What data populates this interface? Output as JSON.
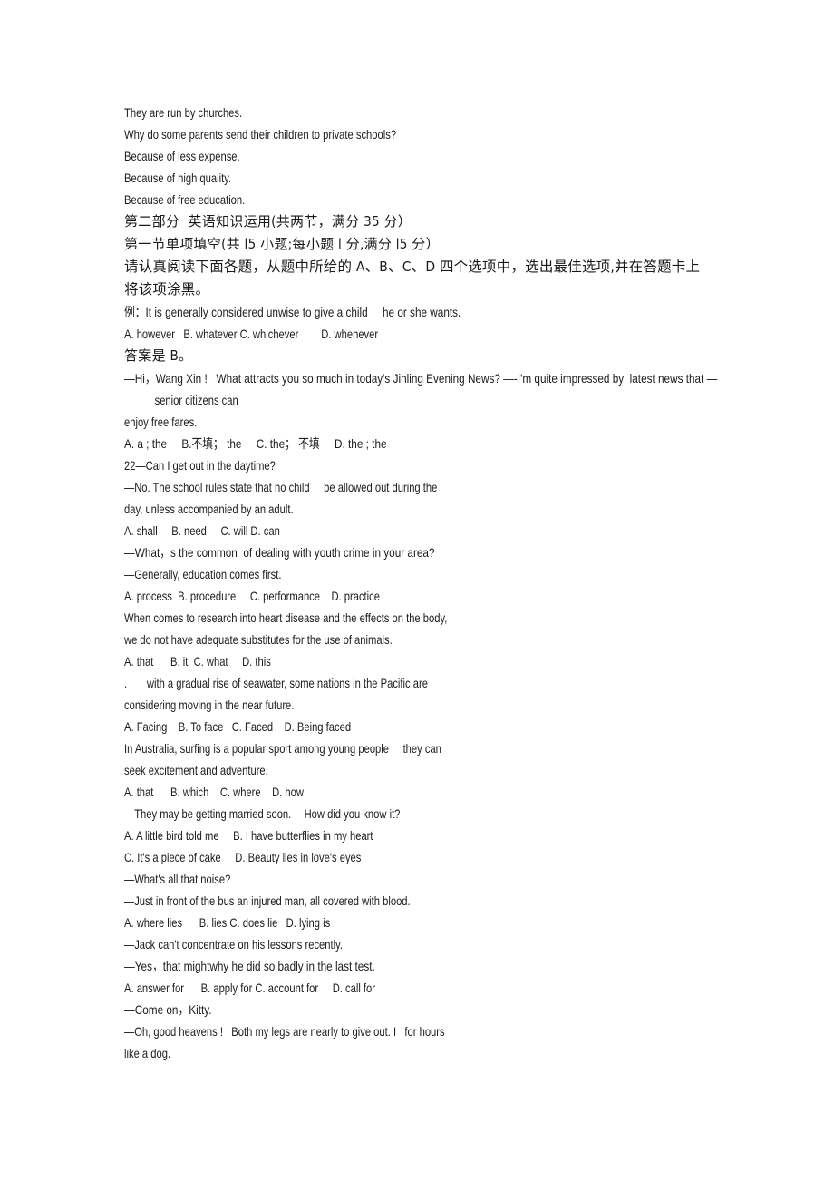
{
  "document": {
    "page_background": "#ffffff",
    "text_color": "#1c1c1c",
    "lines": [
      {
        "id": "l01",
        "text": "They are run by churches.",
        "script": "latin",
        "indent": false
      },
      {
        "id": "l02",
        "text": "Why do some parents send their children to private schools?",
        "script": "latin",
        "indent": false
      },
      {
        "id": "l03",
        "text": "Because of less expense.",
        "script": "latin",
        "indent": false
      },
      {
        "id": "l04",
        "text": "Because of high quality.",
        "script": "latin",
        "indent": false
      },
      {
        "id": "l05",
        "text": "Because of free education.",
        "script": "latin",
        "indent": false
      },
      {
        "id": "l06",
        "text": "第二部分  英语知识运用(共两节，满分 35 分）",
        "script": "cjk",
        "indent": false
      },
      {
        "id": "l07",
        "text": "第一节单项填空(共 l5 小题;每小题 l 分,满分 l5 分）",
        "script": "cjk",
        "indent": false
      },
      {
        "id": "l08",
        "text": "请认真阅读下面各题，从题中所给的 A、B、C、D 四个选项中，选出最佳选项,并在答题卡上",
        "script": "cjk-wide",
        "indent": false
      },
      {
        "id": "l09",
        "text": "将该项涂黑。",
        "script": "cjk-wide",
        "indent": false
      },
      {
        "id": "l10",
        "text": "例：It is generally considered unwise to give a child     he or she wants.",
        "script": "mix",
        "indent": false
      },
      {
        "id": "l11",
        "text": "A. however   B. whatever C. whichever        D. whenever",
        "script": "latin",
        "indent": false
      },
      {
        "id": "l12",
        "text": "答案是 B。",
        "script": "cjk",
        "indent": false
      },
      {
        "id": "l13",
        "text": "—Hi，Wang Xin !   What attracts you so much in today's Jinling Evening News? —-I'm quite impressed by  latest news that —",
        "script": "mix",
        "indent": false
      },
      {
        "id": "l14",
        "text": "senior citizens can",
        "script": "latin",
        "indent": true
      },
      {
        "id": "l15",
        "text": "enjoy free fares.",
        "script": "latin",
        "indent": false
      },
      {
        "id": "l16",
        "text": "A. a ; the     B.不填； the     C. the； 不填     D. the ; the",
        "script": "mix",
        "indent": false
      },
      {
        "id": "l17",
        "text": "22—Can I get out in the daytime?",
        "script": "latin",
        "indent": false
      },
      {
        "id": "l18",
        "text": "—No. The school rules state that no child     be allowed out during the",
        "script": "latin",
        "indent": false
      },
      {
        "id": "l19",
        "text": "day, unless accompanied by an adult.",
        "script": "latin",
        "indent": false
      },
      {
        "id": "l20",
        "text": "A. shall     B. need     C. will D. can",
        "script": "latin",
        "indent": false
      },
      {
        "id": "l21",
        "text": "—What，s the common  of dealing with youth crime in your area?",
        "script": "mix",
        "indent": false
      },
      {
        "id": "l22",
        "text": "—Generally, education comes first.",
        "script": "latin",
        "indent": false
      },
      {
        "id": "l23",
        "text": "A. process  B. procedure     C. performance    D. practice",
        "script": "latin",
        "indent": false
      },
      {
        "id": "l24",
        "text": "When comes to research into heart disease and the effects on the body,",
        "script": "latin",
        "indent": false
      },
      {
        "id": "l25",
        "text": "we do not have adequate substitutes for the use of animals.",
        "script": "latin",
        "indent": false
      },
      {
        "id": "l26",
        "text": "A. that      B. it  C. what     D. this",
        "script": "latin",
        "indent": false
      },
      {
        "id": "l27",
        "text": ".       with a gradual rise of seawater, some nations in the Pacific are",
        "script": "latin",
        "indent": false
      },
      {
        "id": "l28",
        "text": "considering moving in the near future.",
        "script": "latin",
        "indent": false
      },
      {
        "id": "l29",
        "text": "A. Facing    B. To face   C. Faced    D. Being faced",
        "script": "latin",
        "indent": false
      },
      {
        "id": "l30",
        "text": "In Australia, surfing is a popular sport among young people     they can",
        "script": "latin",
        "indent": false
      },
      {
        "id": "l31",
        "text": "seek excitement and adventure.",
        "script": "latin",
        "indent": false
      },
      {
        "id": "l32",
        "text": "A. that      B. which    C. where    D. how",
        "script": "latin",
        "indent": false
      },
      {
        "id": "l33",
        "text": "—They may be getting married soon. —How did you know it?",
        "script": "latin",
        "indent": false
      },
      {
        "id": "l34",
        "text": "A. A little bird told me     B. I have butterflies in my heart",
        "script": "latin",
        "indent": false
      },
      {
        "id": "l35",
        "text": "C. It's a piece of cake     D. Beauty lies in love's eyes",
        "script": "latin",
        "indent": false
      },
      {
        "id": "l36",
        "text": "—What's all that noise?",
        "script": "latin",
        "indent": false
      },
      {
        "id": "l37",
        "text": "—Just in front of the bus an injured man, all covered with blood.",
        "script": "latin",
        "indent": false
      },
      {
        "id": "l38",
        "text": "A. where lies      B. lies C. does lie   D. lying is",
        "script": "latin",
        "indent": false
      },
      {
        "id": "l39",
        "text": "—Jack can't concentrate on his lessons recently.",
        "script": "latin",
        "indent": false
      },
      {
        "id": "l40",
        "text": "—Yes，that mightwhy he did so badly in the last test.",
        "script": "mix",
        "indent": false
      },
      {
        "id": "l41",
        "text": "A. answer for      B. apply for C. account for     D. call for",
        "script": "latin",
        "indent": false
      },
      {
        "id": "l42",
        "text": "—Come on，Kitty.",
        "script": "mix",
        "indent": false
      },
      {
        "id": "l43",
        "text": "—Oh, good heavens !   Both my legs are nearly to give out. I   for hours",
        "script": "latin",
        "indent": false
      },
      {
        "id": "l44",
        "text": "like a dog.",
        "script": "latin",
        "indent": false
      }
    ]
  }
}
